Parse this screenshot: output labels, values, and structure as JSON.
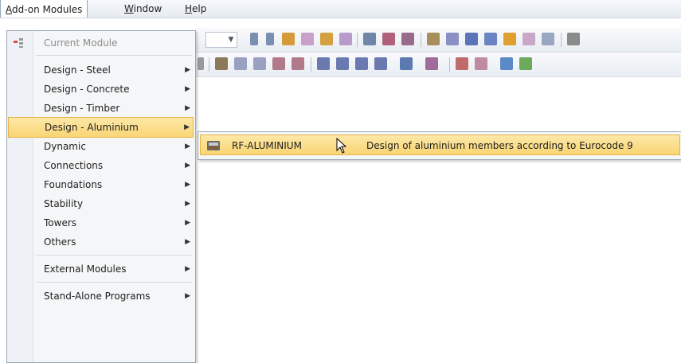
{
  "menubar": {
    "items": [
      {
        "mnemonic": "A",
        "rest": "dd-on Modules"
      },
      {
        "mnemonic": "W",
        "rest": "indow"
      },
      {
        "mnemonic": "H",
        "rest": "elp"
      }
    ]
  },
  "dropdown": {
    "current_module": "Current Module",
    "items": [
      "Design - Steel",
      "Design - Concrete",
      "Design - Timber",
      "Design - Aluminium",
      "Dynamic",
      "Connections",
      "Foundations",
      "Stability",
      "Towers",
      "Others",
      "External Modules",
      "Stand-Alone Programs"
    ],
    "highlighted": "Design - Aluminium"
  },
  "submenu": {
    "name": "RF-ALUMINIUM",
    "description": "Design of aluminium members according to Eurocode 9"
  },
  "colors": {
    "highlight": "#f9d574",
    "highlight_border": "#e7b44a",
    "menu_bg": "#f5f6f7"
  }
}
